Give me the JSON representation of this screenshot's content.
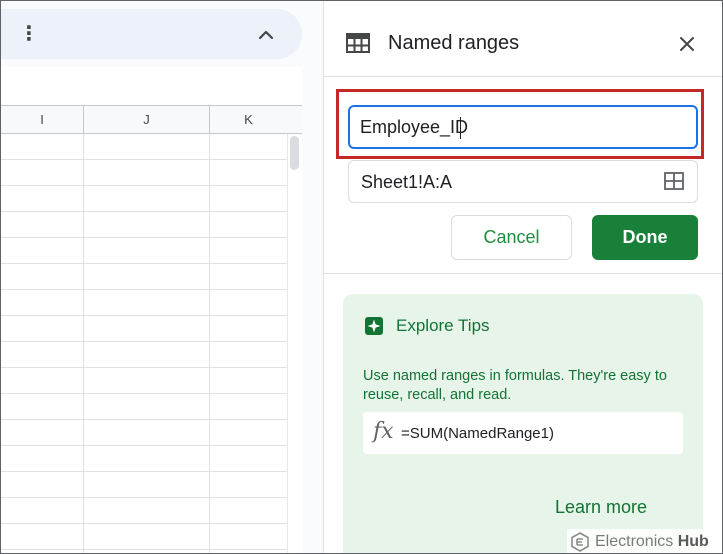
{
  "sheet": {
    "columns": [
      "I",
      "J",
      "K"
    ]
  },
  "panel": {
    "title": "Named ranges",
    "name_value": "Employee_ID",
    "range_value": "Sheet1!A:A",
    "cancel_label": "Cancel",
    "done_label": "Done"
  },
  "tips": {
    "title": "Explore Tips",
    "body": "Use named ranges in formulas. They're easy to reuse, recall, and read.",
    "fx_symbol": "fx",
    "formula": "=SUM(NamedRange1)",
    "learn_more": "Learn more"
  },
  "watermark": {
    "text_light": "Electronics",
    "text_bold": "Hub"
  },
  "icons": {
    "more": "kebab-menu-icon",
    "collapse": "chevron-up-icon",
    "panel": "table-icon",
    "close": "close-icon",
    "range_select": "grid-select-icon",
    "tips": "sparkle-icon",
    "formula": "fx-icon"
  },
  "colors": {
    "accent_green": "#188038",
    "tips_bg": "#e6f4ea",
    "focus_blue": "#1a73e8",
    "highlight_red": "#c62828"
  }
}
